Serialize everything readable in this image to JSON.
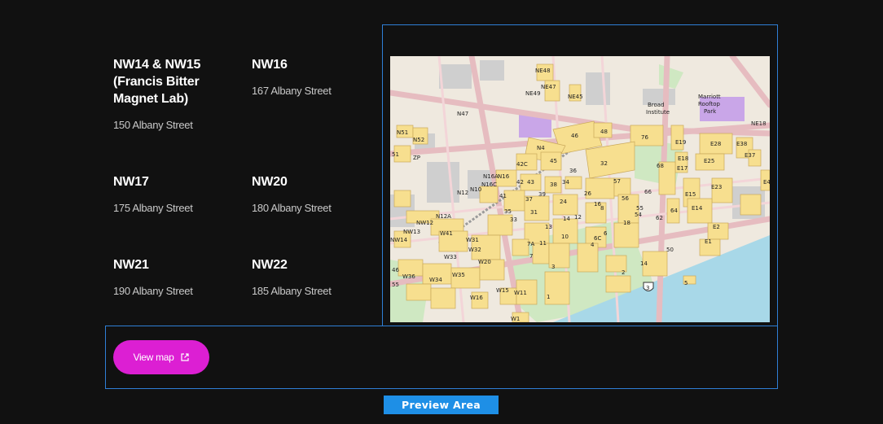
{
  "locations": [
    {
      "name": "NW14 & NW15 (Francis Bitter Magnet Lab)",
      "address": "150 Albany Street"
    },
    {
      "name": "NW16",
      "address": "167 Albany Street"
    },
    {
      "name": "NW17",
      "address": "175 Albany Street"
    },
    {
      "name": "NW20",
      "address": "180 Albany Street"
    },
    {
      "name": "NW21",
      "address": "190 Albany Street"
    },
    {
      "name": "NW22",
      "address": "185 Albany Street"
    }
  ],
  "map": {
    "building_labels": [
      "NE48",
      "NE47",
      "NE49",
      "NE45",
      "N47",
      "Broad Institute",
      "Marriott Rooftop Park",
      "NE18",
      "N51",
      "N52",
      "ZP",
      "46",
      "48",
      "76",
      "E19",
      "E28",
      "E38",
      "E37",
      "N4",
      "42C",
      "45",
      "32",
      "E18",
      "E25",
      "N16A",
      "N16",
      "N16C",
      "42",
      "43",
      "38",
      "34",
      "36",
      "57",
      "E17",
      "68",
      "E23",
      "N12",
      "N10",
      "41",
      "37",
      "39",
      "26",
      "56",
      "66",
      "E15",
      "E4",
      "N12A",
      "NW12",
      "35",
      "33",
      "31",
      "24",
      "16",
      "55",
      "54",
      "62",
      "64",
      "E14",
      "NW13",
      "W41",
      "13",
      "14",
      "12",
      "8",
      "18",
      "E2",
      "NW14",
      "W31",
      "W32",
      "7A",
      "11",
      "10",
      "4",
      "6C",
      "6",
      "E1",
      "W33",
      "W20",
      "7",
      "3",
      "2",
      "50",
      "W36",
      "W34",
      "W35",
      "14",
      "W15",
      "W11",
      "W16",
      "1",
      "W1",
      "5",
      "55",
      "46",
      "3",
      "NW"
    ],
    "water_color": "#a8d8e8",
    "building_color": "#f7df8f",
    "park_color": "#cfe8c2",
    "road_color": "#e6bcc0"
  },
  "view_map_label": "View map",
  "preview_label": "Preview Area",
  "colors": {
    "accent_button": "#dc1fd3",
    "outline": "#2f7fd6",
    "preview_badge": "#1e8fe6",
    "background": "#111111"
  }
}
